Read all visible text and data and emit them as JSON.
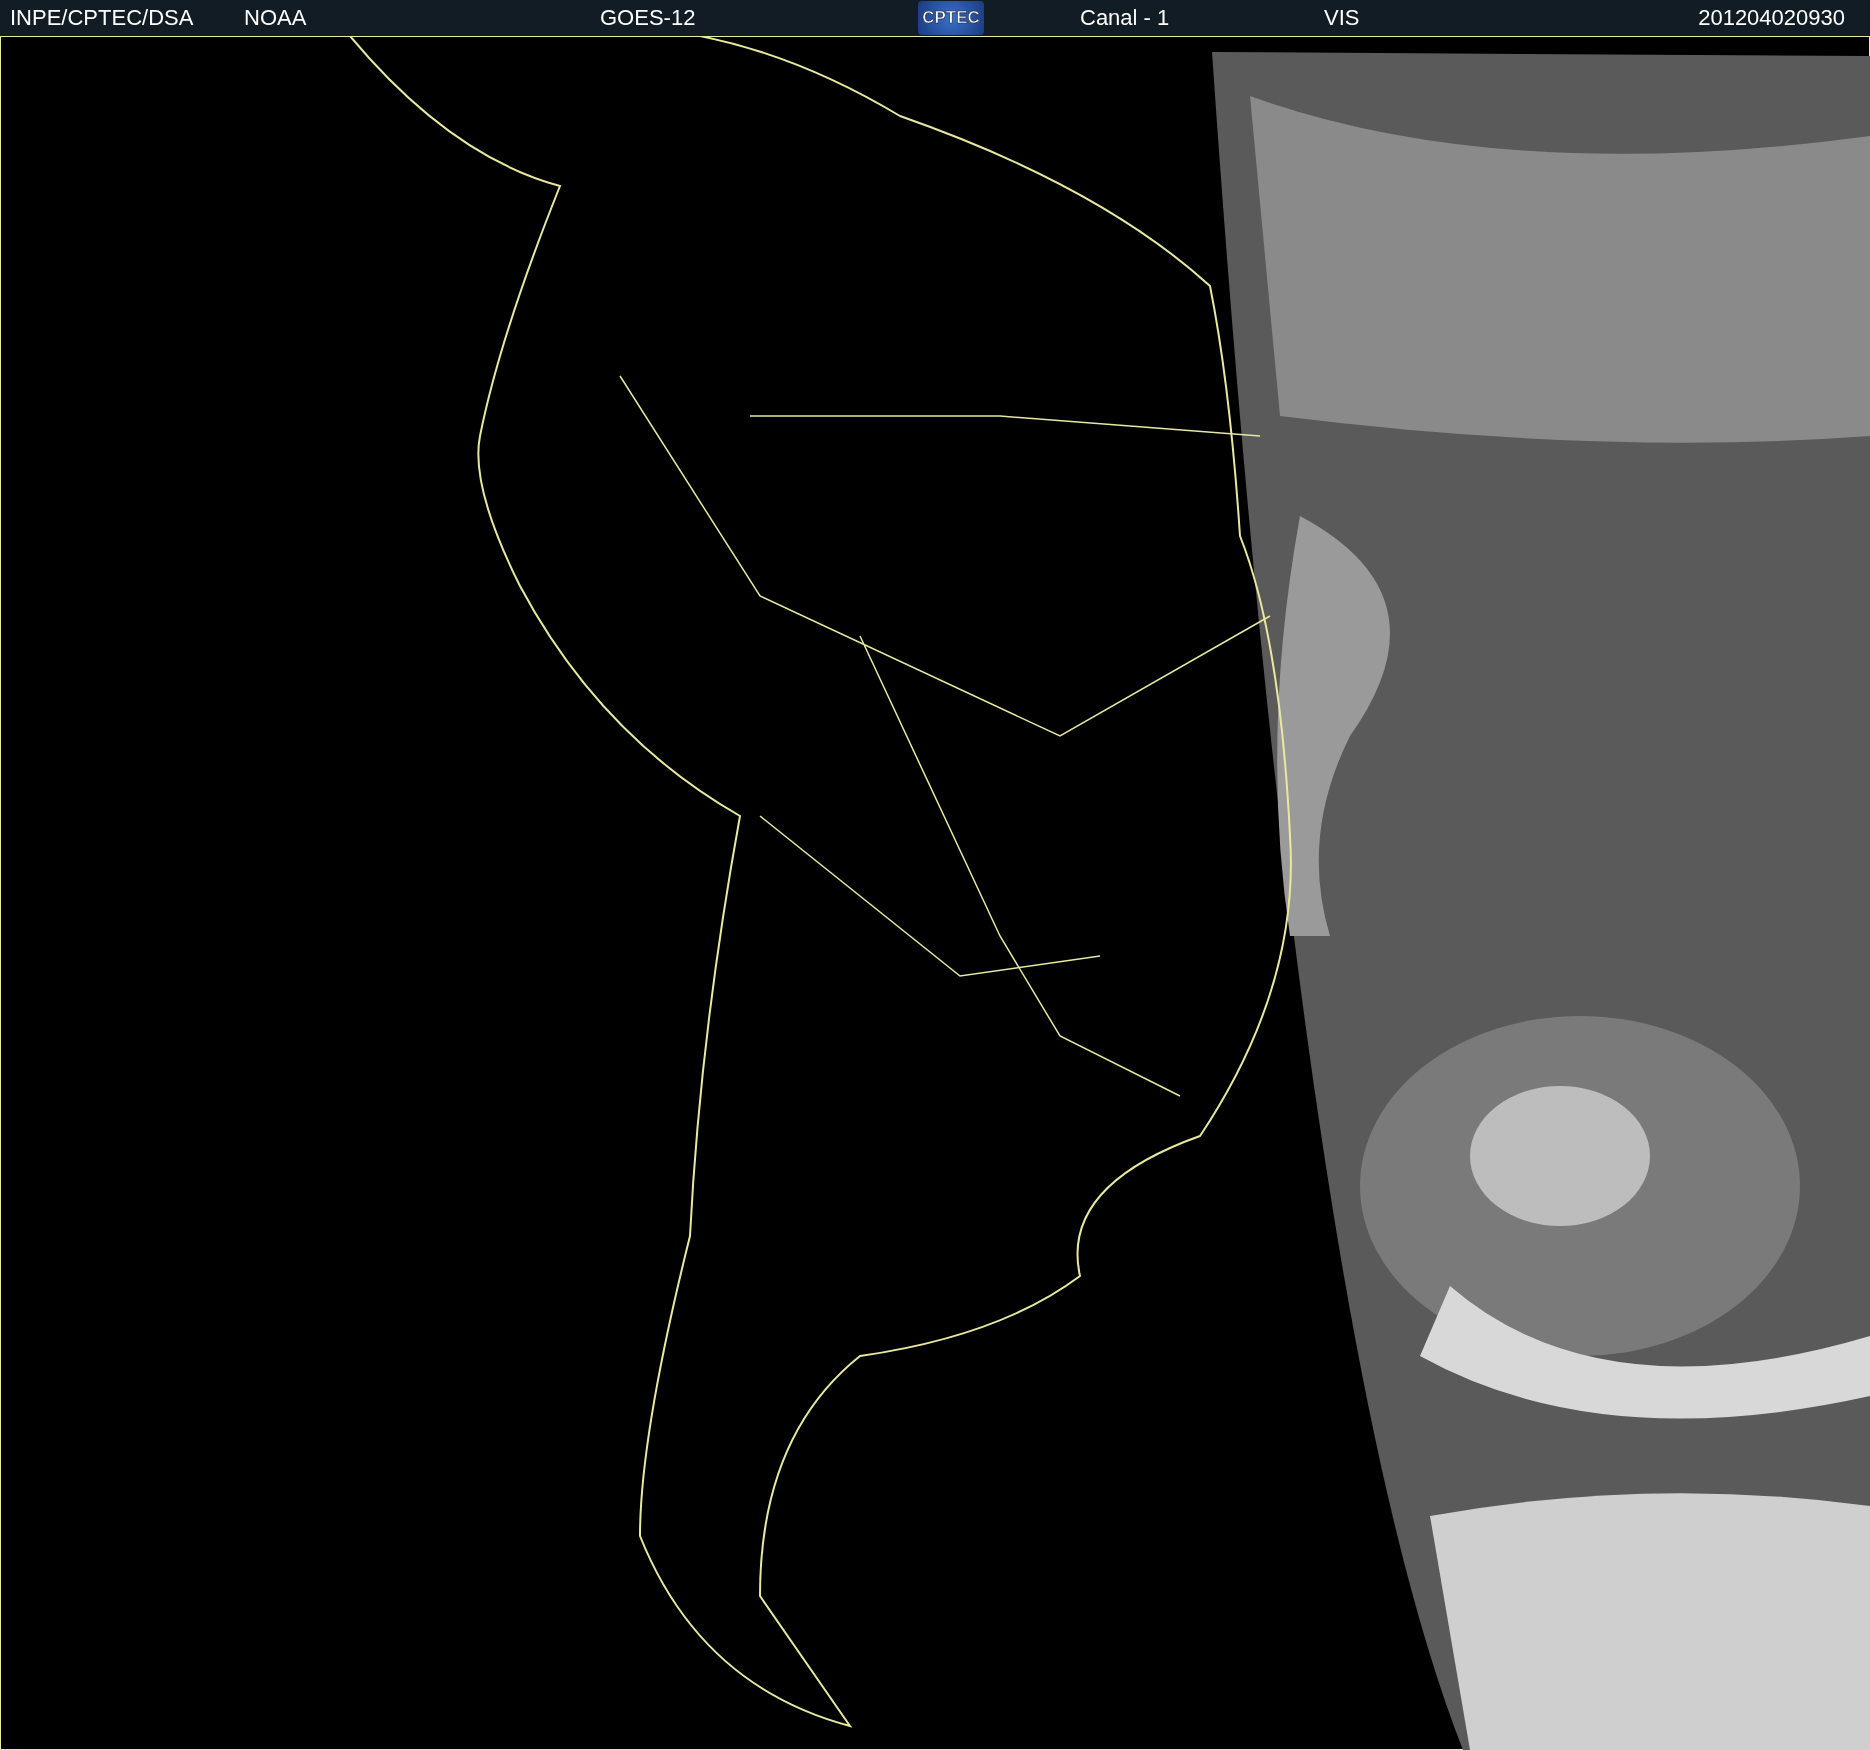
{
  "header": {
    "agency": "INPE/CPTEC/DSA",
    "source": "NOAA",
    "satellite": "GOES-12",
    "logo_text": "CPTEC",
    "channel": "Canal - 1",
    "band": "VIS",
    "timestamp": "201204020930"
  }
}
